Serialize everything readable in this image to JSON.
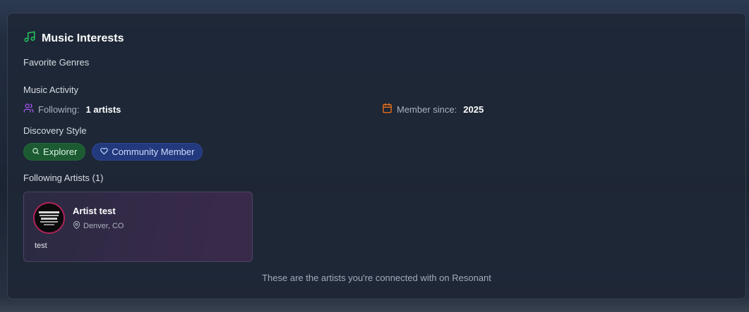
{
  "section": {
    "title": "Music Interests",
    "icon": "music-note-icon",
    "accent": "#22c55e"
  },
  "favorite_genres": {
    "label": "Favorite Genres"
  },
  "music_activity": {
    "label": "Music Activity",
    "following": {
      "key": "Following:",
      "value": "1 artists",
      "icon": "users-icon",
      "icon_color": "#a855f7"
    },
    "member_since": {
      "key": "Member since:",
      "value": "2025",
      "icon": "calendar-icon",
      "icon_color": "#f97316"
    }
  },
  "discovery_style": {
    "label": "Discovery Style",
    "badges": [
      {
        "label": "Explorer",
        "icon": "search-icon",
        "bg": "#1c5a32"
      },
      {
        "label": "Community Member",
        "icon": "heart-icon",
        "bg": "#22397d"
      }
    ]
  },
  "following_artists": {
    "label": "Following Artists (1)",
    "artists": [
      {
        "name": "Artist test",
        "location": "Denver, CO",
        "bio": "test",
        "avatar_icon": "artist-logo-avatar"
      }
    ]
  },
  "footer_note": "These are the artists you're connected with on Resonant"
}
